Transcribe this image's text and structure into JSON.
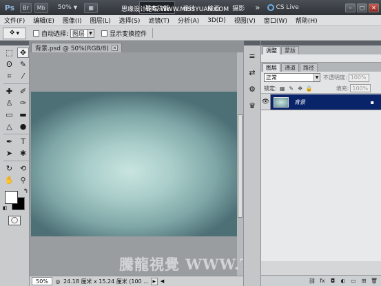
{
  "appbar": {
    "logo": "Ps",
    "bridge_label": "Br",
    "minibridge_label": "Mb",
    "zoom": "50%",
    "workspaces": [
      "基本功能",
      "设计",
      "绘画",
      "摄影"
    ],
    "more": "»",
    "cslive": "CS Live",
    "watermark": "思缘设计论坛 WWW.MISSYUAN.COM",
    "win_min": "–",
    "win_max": "□",
    "win_close": "✕"
  },
  "menubar": {
    "items": [
      "文件(F)",
      "编辑(E)",
      "图像(I)",
      "图层(L)",
      "选择(S)",
      "滤镜(T)",
      "分析(A)",
      "3D(D)",
      "视图(V)",
      "窗口(W)",
      "帮助(H)"
    ]
  },
  "options": {
    "auto_select_label": "自动选择:",
    "auto_select_value": "图层",
    "show_transform_label": "显示变换控件"
  },
  "document": {
    "tab_title": "背景.psd @ 50%(RGB/8)",
    "zoom": "50%",
    "doc_size": "24.18 厘米 x 15.24 厘米 (100 ..."
  },
  "watermark": "騰龍視覺 WWW.TLVI.NET",
  "panels": {
    "top_tabs": [
      "调整",
      "蒙版"
    ],
    "layer_tabs": [
      "图层",
      "通道",
      "路径"
    ],
    "blend_mode": "正常",
    "opacity_label": "不透明度:",
    "opacity_value": "100%",
    "lock_label": "锁定:",
    "fill_label": "填充:",
    "fill_value": "100%",
    "layers": [
      {
        "name": "背景",
        "visible": true,
        "locked": true
      }
    ]
  },
  "colors": {
    "foreground": "#ffffff",
    "background": "#000000",
    "layer_selected": "#0a246a",
    "canvas_center": "#c8e4e0",
    "canvas_edge": "#4d6f76"
  }
}
